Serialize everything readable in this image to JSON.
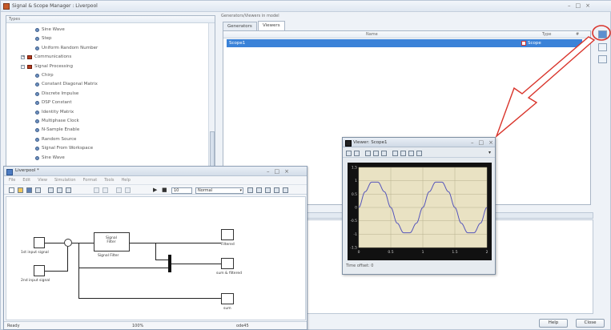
{
  "main_window": {
    "title": "Signal & Scope Manager : Liverpool",
    "buttons": [
      "–",
      "□",
      "×"
    ]
  },
  "tree": {
    "header": "Types",
    "rows": [
      {
        "label": "Sine Wave",
        "kind": "leaf",
        "indent": 2
      },
      {
        "label": "Step",
        "kind": "leaf",
        "indent": 2
      },
      {
        "label": "Uniform Random Number",
        "kind": "leaf",
        "indent": 2
      },
      {
        "label": "Communications",
        "kind": "folder",
        "indent": 1,
        "expander": "+"
      },
      {
        "label": "Signal Processing",
        "kind": "folder",
        "indent": 1,
        "expander": "–"
      },
      {
        "label": "Chirp",
        "kind": "leaf",
        "indent": 2
      },
      {
        "label": "Constant Diagonal Matrix",
        "kind": "leaf",
        "indent": 2
      },
      {
        "label": "Discrete Impulse",
        "kind": "leaf",
        "indent": 2
      },
      {
        "label": "DSP Constant",
        "kind": "leaf",
        "indent": 2
      },
      {
        "label": "Identity Matrix",
        "kind": "leaf",
        "indent": 2
      },
      {
        "label": "Multiphase Clock",
        "kind": "leaf",
        "indent": 2
      },
      {
        "label": "N-Sample Enable",
        "kind": "leaf",
        "indent": 2
      },
      {
        "label": "Random Source",
        "kind": "leaf",
        "indent": 2
      },
      {
        "label": "Signal From Workspace",
        "kind": "leaf",
        "indent": 2
      },
      {
        "label": "Sine Wave",
        "kind": "leaf",
        "indent": 2
      }
    ]
  },
  "right_panel": {
    "group_label": "Generators/Viewers in model",
    "tabs": [
      "Generators",
      "Viewers"
    ],
    "columns": [
      "Name",
      "Type",
      "#"
    ],
    "row": {
      "name": "Scope1",
      "type": "Scope"
    }
  },
  "bottom_buttons": {
    "help": "Help",
    "close": "Close"
  },
  "model_window": {
    "title": "Liverpool *",
    "menu": [
      "File",
      "Edit",
      "View",
      "Simulation",
      "Format",
      "Tools",
      "Help"
    ],
    "sim_time": "10",
    "sim_mode": "Normal",
    "status": {
      "left": "Ready",
      "zoom": "100%",
      "solver": "ode45"
    },
    "blocks": {
      "filter_title": "Signal\nFilter",
      "filter_label": "Signal Filter",
      "in1_label": "1st input signal",
      "in2_label": "2nd input signal",
      "out1_label": "Filtered",
      "out2_label": "sum & filtered",
      "out3_label": "sum"
    }
  },
  "scope_window": {
    "title": "Viewer: Scope1",
    "status": "Time offset:   0",
    "chart_data": {
      "type": "line",
      "x": [
        0,
        0.1,
        0.2,
        0.3,
        0.4,
        0.5,
        0.6,
        0.7,
        0.8,
        0.9,
        1.0,
        1.1,
        1.2,
        1.3,
        1.4,
        1.5,
        1.6,
        1.7,
        1.8,
        1.9,
        2.0
      ],
      "series": [
        {
          "values": [
            0,
            0.59,
            0.95,
            0.95,
            0.59,
            0,
            -0.59,
            -0.95,
            -0.95,
            -0.59,
            0,
            0.59,
            0.95,
            0.95,
            0.59,
            0,
            -0.59,
            -0.95,
            -0.95,
            -0.59,
            0
          ]
        }
      ],
      "xlim": [
        0,
        2
      ],
      "ylim": [
        -1.5,
        1.5
      ],
      "xticks": [
        "0",
        "0.5",
        "1",
        "1.5",
        "2"
      ],
      "yticks": [
        "1.5",
        "1",
        "0.5",
        "0",
        "-0.5",
        "-1",
        "-1.5"
      ],
      "grid": true,
      "line_color": "#5555bb",
      "background": "#e9e2c3"
    }
  },
  "colors": {
    "accent": "#3a82d8",
    "annotation_arrow": "#d9342b"
  }
}
